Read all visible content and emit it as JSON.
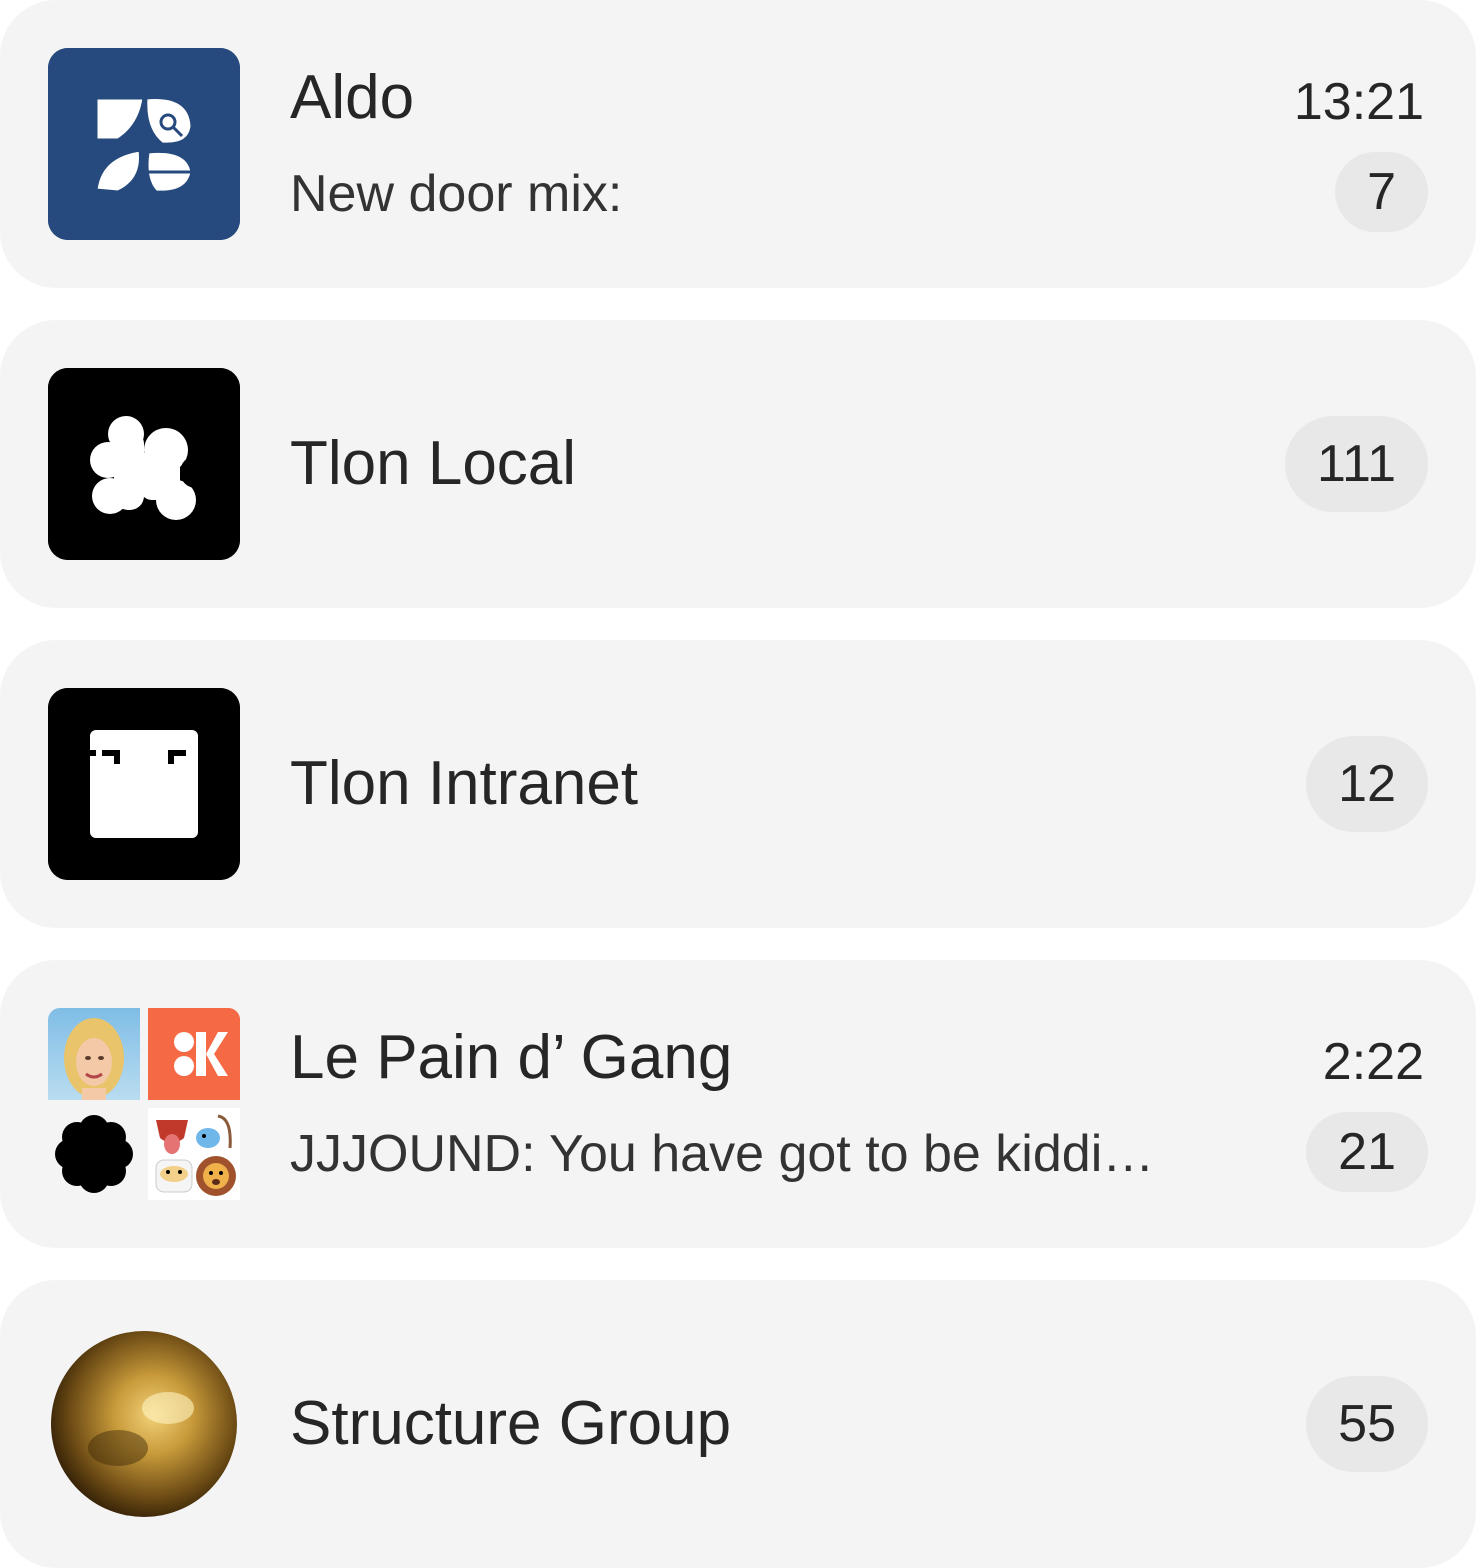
{
  "colors": {
    "row_background": "#f4f4f4",
    "badge_background": "#e8e8e8",
    "text": "#262626",
    "aldo_avatar": "#264a7d",
    "orange_avatar": "#f56a45",
    "black_avatar": "#000000"
  },
  "groups": [
    {
      "title": "Aldo",
      "subtitle": "New door mix:",
      "time": "13:21",
      "unread": "7",
      "avatar_icon": "aldo-logo-icon"
    },
    {
      "title": "Tlon Local",
      "subtitle": "",
      "time": "",
      "unread": "111",
      "avatar_icon": "tlon-local-logo-icon"
    },
    {
      "title": "Tlon Intranet",
      "subtitle": "",
      "time": "",
      "unread": "12",
      "avatar_icon": "tlon-intranet-logo-icon"
    },
    {
      "title": "Le Pain d’ Gang",
      "subtitle": "JJJOUND: You have got to be kiddi…",
      "time": "2:22",
      "unread": "21",
      "avatar_icon": "member-avatars-grid-icon"
    },
    {
      "title": "Structure Group",
      "subtitle": "",
      "time": "",
      "unread": "55",
      "avatar_icon": "gold-sphere-icon"
    }
  ]
}
